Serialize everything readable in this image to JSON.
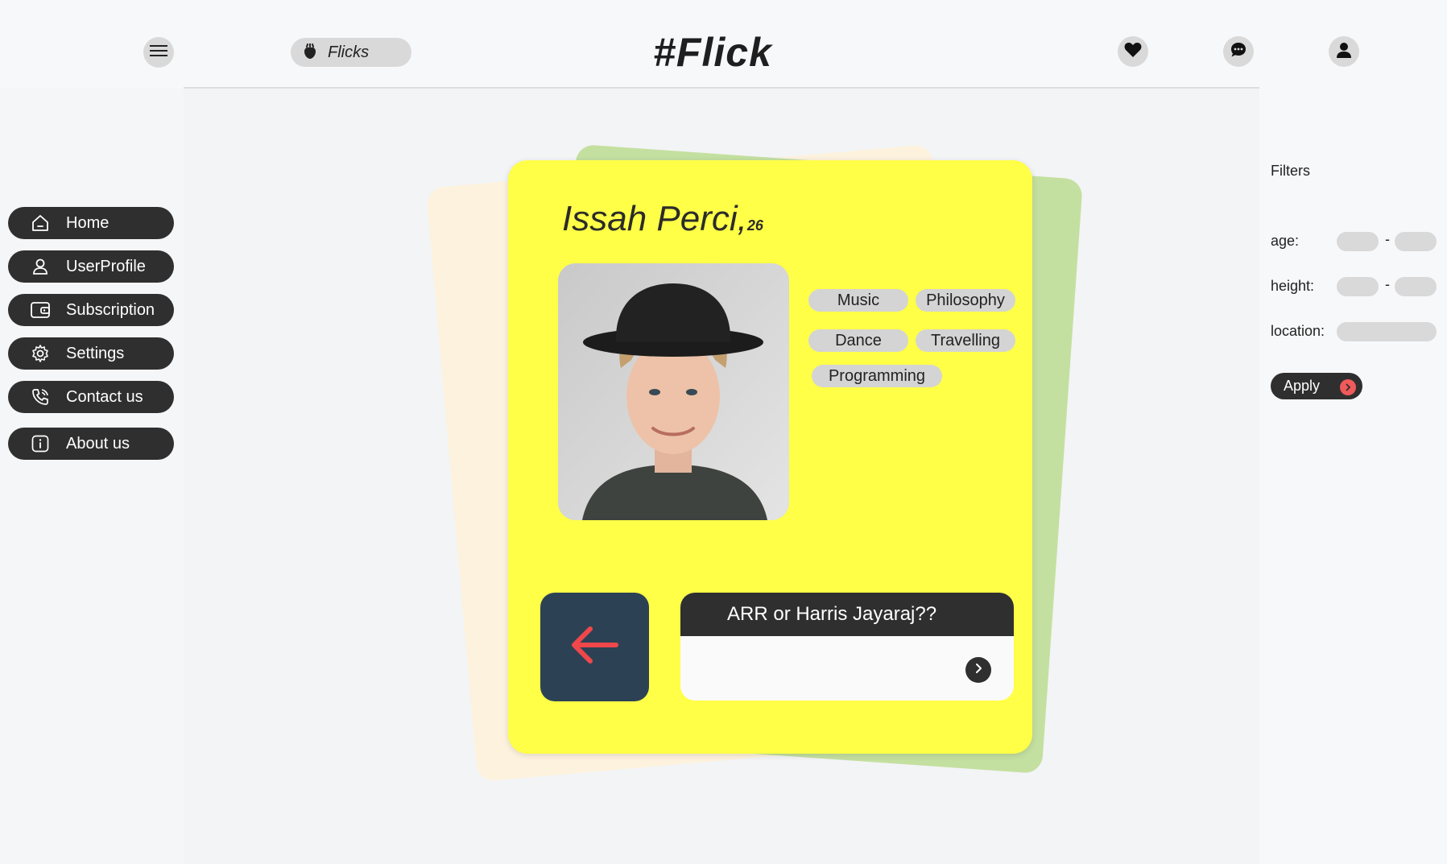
{
  "header": {
    "flicks_label": "Flicks",
    "logo": "#Flick",
    "icons": [
      "menu-icon",
      "flicks-icon",
      "heart-icon",
      "chat-icon",
      "user-icon"
    ]
  },
  "sidebar": {
    "items": [
      {
        "label": "Home",
        "icon": "home-icon"
      },
      {
        "label": "UserProfile",
        "icon": "user-icon"
      },
      {
        "label": "Subscription",
        "icon": "wallet-icon"
      },
      {
        "label": "Settings",
        "icon": "gear-icon"
      },
      {
        "label": "Contact us",
        "icon": "phone-icon"
      },
      {
        "label": "About us",
        "icon": "info-icon"
      }
    ]
  },
  "profile": {
    "name": "Issah Perci,",
    "age": "26",
    "interests": [
      "Music",
      "Philosophy",
      "Dance",
      "Travelling",
      "Programming"
    ],
    "prompt": "ARR or Harris Jayaraj??"
  },
  "filters": {
    "title": "Filters",
    "age_label": "age:",
    "height_label": "height:",
    "location_label": "location:",
    "range_separator": "-",
    "apply_label": "Apply"
  },
  "colors": {
    "card": "#ffff47",
    "back_card_1": "#fdf2dd",
    "back_card_2": "#c4e0a0",
    "dark": "#2f2f2f",
    "back_button": "#2c4254",
    "accent_red": "#f05a5a"
  }
}
